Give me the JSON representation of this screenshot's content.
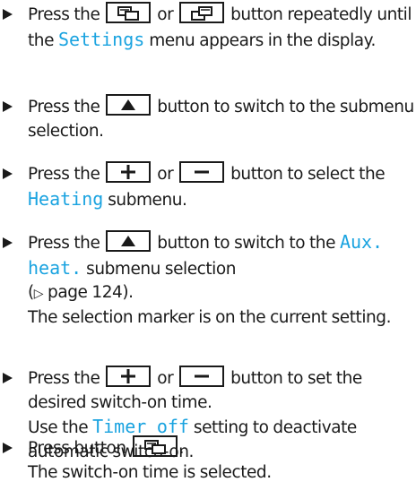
{
  "steps": [
    {
      "before": "Press the ",
      "mid": " or ",
      "after": " button repeatedly until the ",
      "hl": "Settings",
      "end": " menu appears in the display."
    },
    {
      "before": "Press the ",
      "after": " button to switch to the sub­menu selection."
    },
    {
      "before": "Press the ",
      "mid": " or ",
      "after": " button to select the ",
      "hl": "Heating",
      "end": " submenu."
    },
    {
      "before": "Press the ",
      "after": " button to switch to the ",
      "hl": "Aux. heat.",
      "end": " submenu selection",
      "ref_glyph": "▷",
      "ref_text": " page 124).",
      "note": "The selection marker is on the current set­ting."
    },
    {
      "before": "Press the ",
      "mid": " or ",
      "after": " button to set the desired switch-on time.",
      "note_before": "Use the ",
      "note_hl": "Timer off",
      "note_after": " setting to deactivate automatic switch-on."
    },
    {
      "before": "Press button ",
      "after": ".",
      "note": "The switch-on time is selected."
    }
  ],
  "icons": {
    "back": "screen-back-key-icon",
    "forward": "screen-forward-key-icon",
    "up": "up-arrow-key-icon",
    "plus": "plus-key-icon",
    "minus": "minus-key-icon",
    "bullet": "triangle-bullet-icon"
  },
  "colors": {
    "highlight": "#1aa3e0",
    "text": "#1a1a1a"
  }
}
